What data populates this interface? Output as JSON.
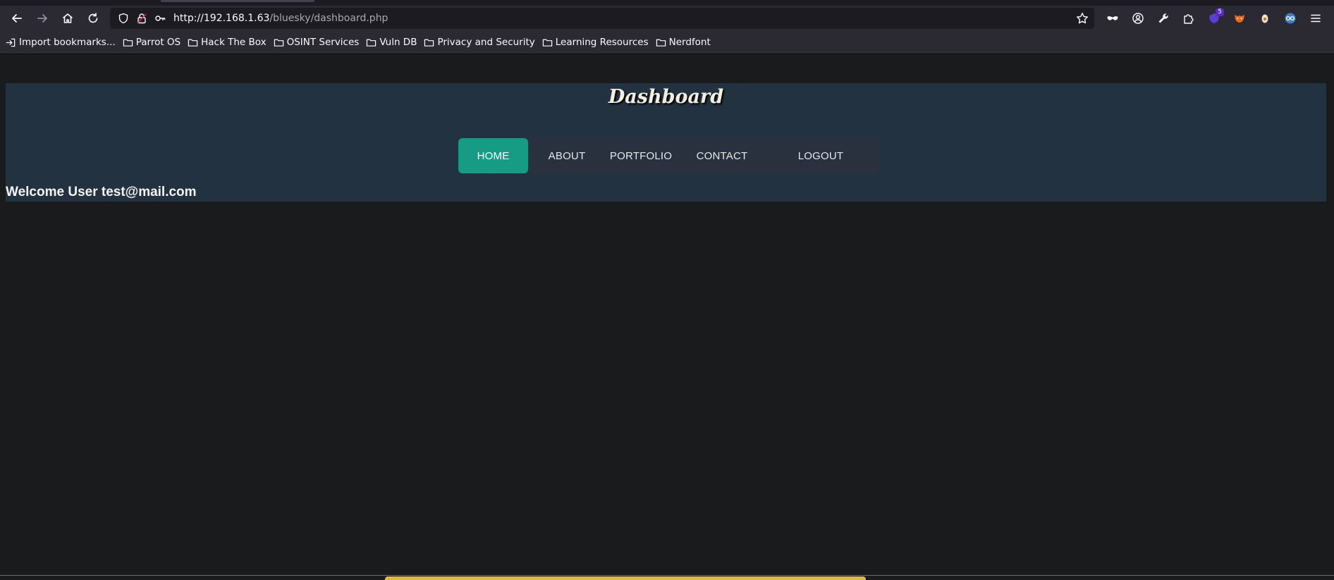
{
  "browser": {
    "url_host": "http://192.168.1.63",
    "url_path": "/bluesky/dashboard.php",
    "extension_badge": "5",
    "bookmarks": [
      {
        "label": "Import bookmarks...",
        "icon": "import-icon"
      },
      {
        "label": "Parrot OS",
        "icon": "folder-icon"
      },
      {
        "label": "Hack The Box",
        "icon": "folder-icon"
      },
      {
        "label": "OSINT Services",
        "icon": "folder-icon"
      },
      {
        "label": "Vuln DB",
        "icon": "folder-icon"
      },
      {
        "label": "Privacy and Security",
        "icon": "folder-icon"
      },
      {
        "label": "Learning Resources",
        "icon": "folder-icon"
      },
      {
        "label": "Nerdfont",
        "icon": "folder-icon"
      }
    ]
  },
  "page": {
    "title": "Dashboard",
    "welcome": "Welcome User test@mail.com",
    "menu": [
      {
        "label": "HOME",
        "active": true
      },
      {
        "label": "ABOUT"
      },
      {
        "label": "PORTFOLIO"
      },
      {
        "label": "CONTACT"
      },
      {
        "label": "LOGOUT"
      }
    ]
  },
  "colors": {
    "header_bg": "#233241",
    "menu_active": "#169c85",
    "page_bg": "#1a1b1d"
  }
}
